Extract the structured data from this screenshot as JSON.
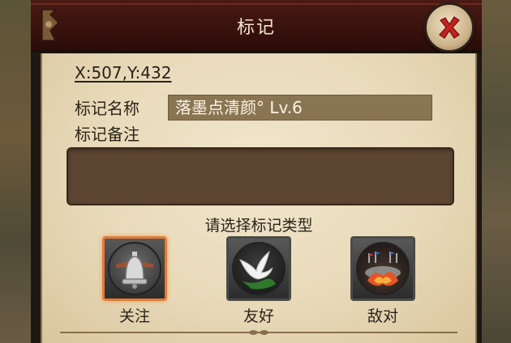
{
  "dialog": {
    "title": "标记",
    "close_icon": "close-x-icon"
  },
  "location": {
    "coords": "X:507,Y:432"
  },
  "form": {
    "name_label": "标记名称",
    "name_value": "落墨点清颜° Lv.6",
    "note_label": "标记备注",
    "note_value": ""
  },
  "mark_types": {
    "prompt": "请选择标记类型",
    "items": [
      {
        "label": "关注",
        "icon": "bell-icon",
        "selected": true
      },
      {
        "label": "友好",
        "icon": "dove-icon",
        "selected": false
      },
      {
        "label": "敌对",
        "icon": "battle-icon",
        "selected": false
      }
    ]
  },
  "colors": {
    "title_bar": "#3a120e",
    "parchment": "#e8dab9",
    "selected_border": "#e57a34",
    "close_x": "#c3231f"
  }
}
